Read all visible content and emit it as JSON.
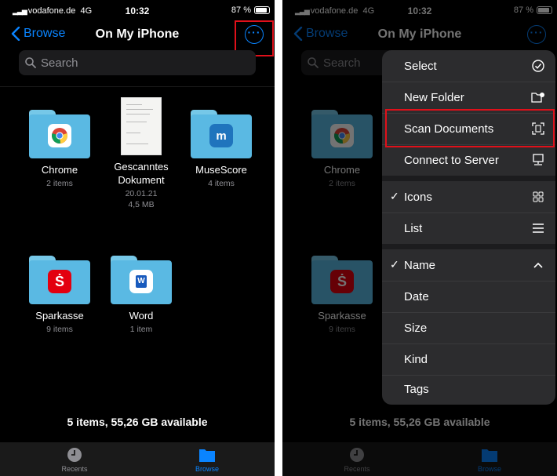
{
  "status": {
    "carrier": "vodafone.de",
    "network": "4G",
    "time": "10:32",
    "battery": "87 %"
  },
  "nav": {
    "back_label": "Browse",
    "title": "On My iPhone"
  },
  "search": {
    "placeholder": "Search"
  },
  "items": [
    {
      "name": "Chrome",
      "meta": "2 items"
    },
    {
      "name": "Gescanntes Dokument",
      "date": "20.01.21",
      "size": "4,5 MB"
    },
    {
      "name": "MuseScore",
      "meta": "4 items"
    },
    {
      "name": "Sparkasse",
      "meta": "9 items"
    },
    {
      "name": "Word",
      "meta": "1 item"
    }
  ],
  "footer": {
    "summary": "5 items, 55,26 GB available"
  },
  "tabbar": {
    "recents": "Recents",
    "browse": "Browse"
  },
  "menu": {
    "select": "Select",
    "new_folder": "New Folder",
    "scan_documents": "Scan Documents",
    "connect_to_server": "Connect to Server",
    "icons": "Icons",
    "list": "List",
    "name": "Name",
    "date": "Date",
    "size": "Size",
    "kind": "Kind",
    "tags": "Tags"
  },
  "colors": {
    "accent": "#0a84ff",
    "highlight": "#e0101a",
    "folder": "#5ab9e3"
  }
}
